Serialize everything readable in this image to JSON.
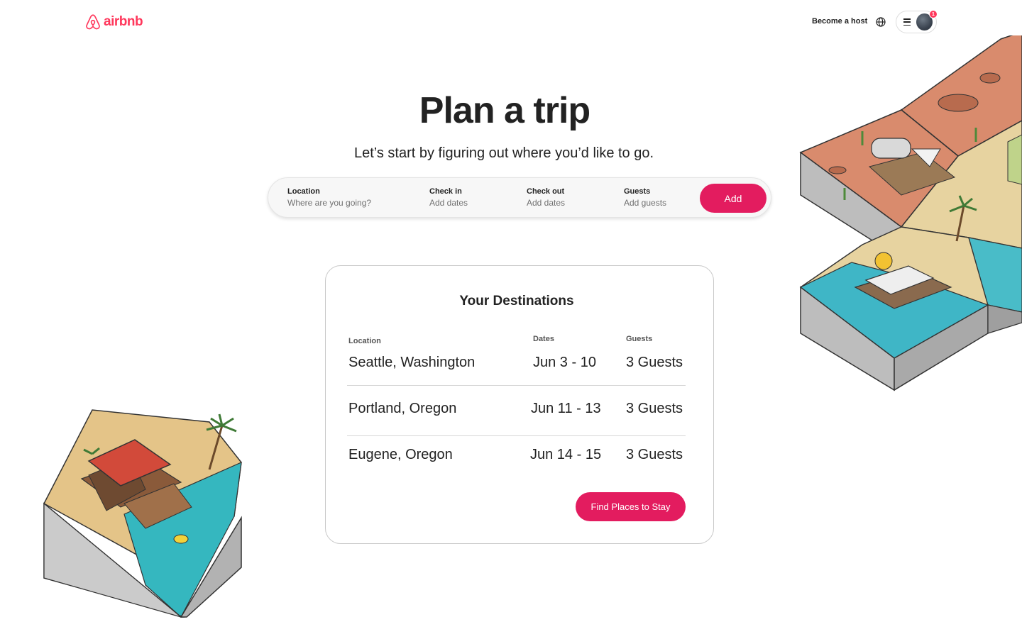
{
  "brand": {
    "name": "airbnb",
    "color": "#ff385c",
    "logo_icon": "airbnb-belo-icon"
  },
  "header": {
    "host_link": "Become a host",
    "globe_icon": "globe-icon",
    "menu_icon": "hamburger-icon",
    "notification_count": "1"
  },
  "hero": {
    "title": "Plan a trip",
    "subtitle": "Let’s start by figuring out where you’d like to go."
  },
  "search": {
    "location": {
      "label": "Location",
      "placeholder": "Where are you going?"
    },
    "check_in": {
      "label": "Check in",
      "placeholder": "Add dates"
    },
    "check_out": {
      "label": "Check out",
      "placeholder": "Add dates"
    },
    "guests": {
      "label": "Guests",
      "placeholder": "Add guests"
    },
    "add_label": "Add"
  },
  "destinations": {
    "title": "Your Destinations",
    "columns": {
      "location": "Location",
      "dates": "Dates",
      "guests": "Guests"
    },
    "rows": [
      {
        "location": "Seattle, Washington",
        "dates": "Jun 3 - 10",
        "guests": "3 Guests"
      },
      {
        "location": "Portland, Oregon",
        "dates": "Jun 11 - 13",
        "guests": "3 Guests"
      },
      {
        "location": "Eugene, Oregon",
        "dates": "Jun 14 - 15",
        "guests": "3 Guests"
      }
    ],
    "find_label": "Find Places to Stay"
  },
  "colors": {
    "accent": "#e31c5f",
    "text": "#222222",
    "muted": "#717171"
  }
}
